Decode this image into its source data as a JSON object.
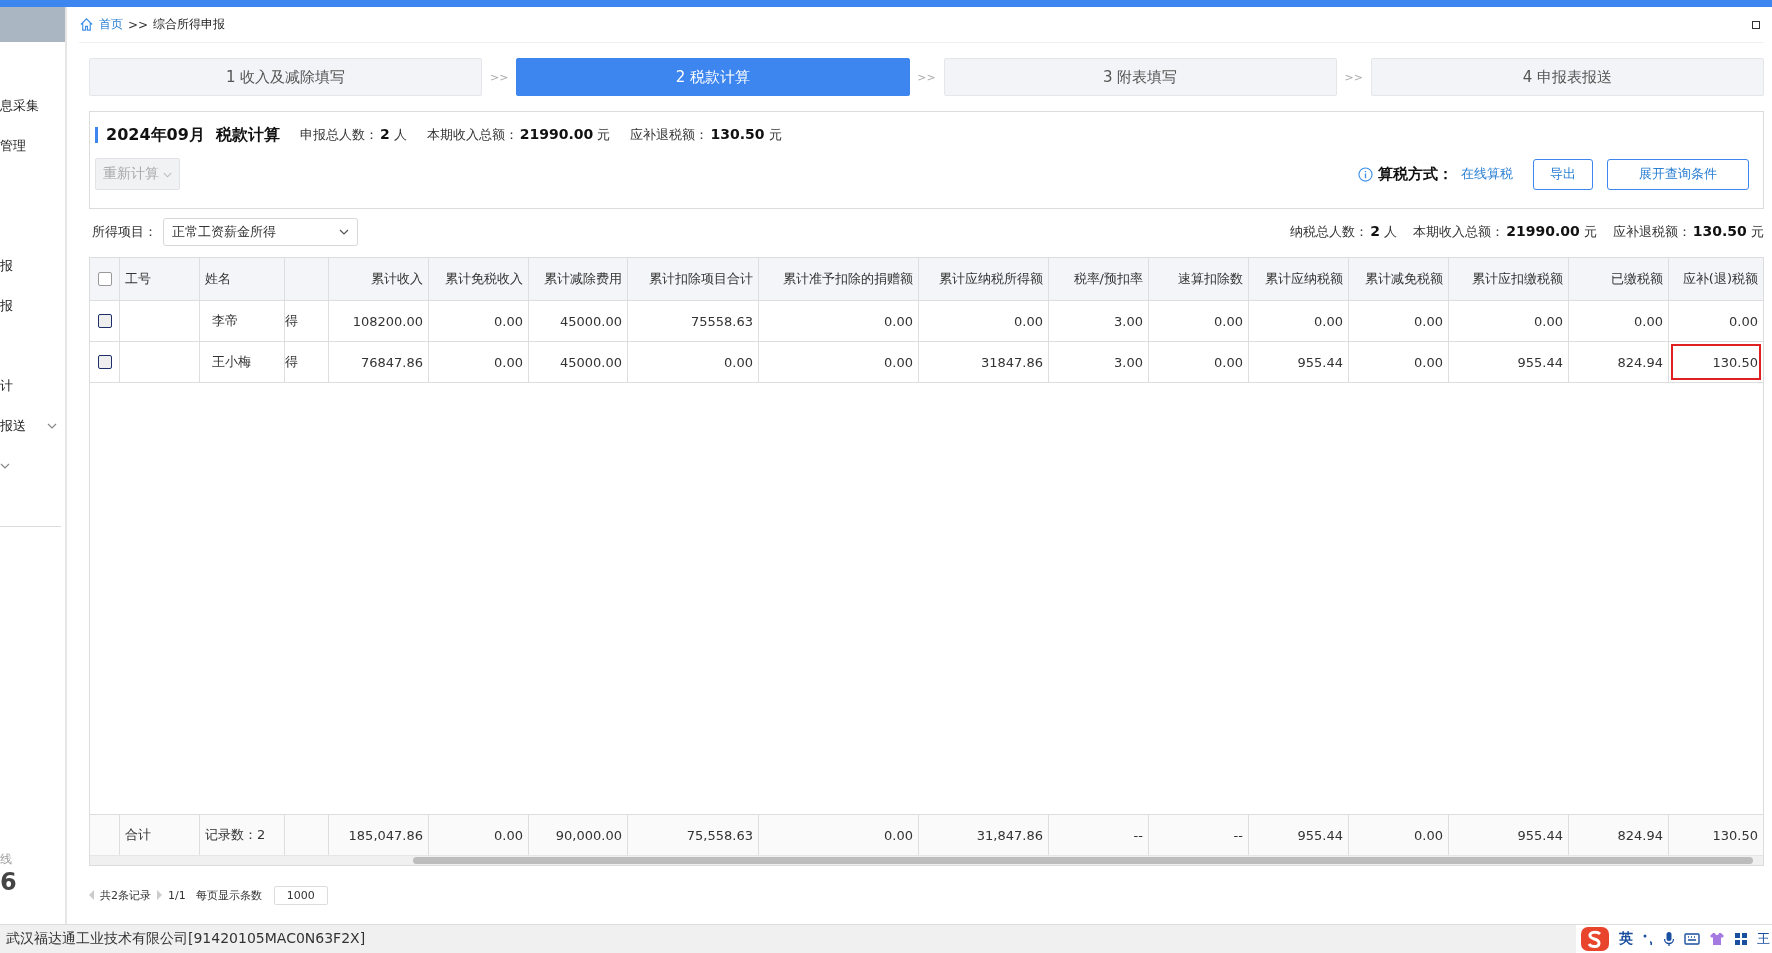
{
  "sidebar": {
    "items": [
      {
        "label": "息采集",
        "expandable": false
      },
      {
        "label": "管理",
        "expandable": false
      },
      {
        "label": "报",
        "expandable": false
      },
      {
        "label": "报",
        "expandable": false
      },
      {
        "label": "计",
        "expandable": false
      },
      {
        "label": "报送",
        "expandable": true
      },
      {
        "expandable": true
      }
    ],
    "footer_label": "线",
    "footer_number": "6"
  },
  "breadcrumb": {
    "home": "首页",
    "separator": ">>",
    "current": "综合所得申报"
  },
  "steps": [
    {
      "label": "1 收入及减除填写",
      "selected": false
    },
    {
      "label": "2 税款计算",
      "selected": true
    },
    {
      "label": "3 附表填写",
      "selected": false
    },
    {
      "label": "4 申报表报送",
      "selected": false
    }
  ],
  "step_separator": ">>",
  "summary": {
    "title": "2024年09月  税款计算",
    "stats": [
      {
        "label": "申报总人数：",
        "value": "2",
        "unit": "人"
      },
      {
        "label": "本期收入总额：",
        "value": "21990.00",
        "unit": "元"
      },
      {
        "label": "应补退税额：",
        "value": "130.50",
        "unit": "元"
      }
    ],
    "recalc_button": {
      "label": "重新计算",
      "disabled": true
    },
    "method_label": "算税方式：",
    "method_value": "在线算税",
    "buttons": [
      "导出",
      "展开查询条件"
    ]
  },
  "filter": {
    "label": "所得项目：",
    "value": "正常工资薪金所得",
    "stats": [
      {
        "label": "纳税总人数：",
        "value": "2",
        "unit": "人"
      },
      {
        "label": "本期收入总额：",
        "value": "21990.00",
        "unit": "元"
      },
      {
        "label": "应补退税额：",
        "value": "130.50",
        "unit": "元"
      }
    ]
  },
  "table": {
    "header_checked": false,
    "columns": [
      "工号",
      "姓名",
      null,
      "累计收入",
      "累计免税收入",
      "累计减除费用",
      "累计扣除项目合计",
      "累计准予扣除的捐赠额",
      "累计应纳税所得额",
      "税率/预扣率",
      "速算扣除数",
      "累计应纳税额",
      "累计减免税额",
      "累计应扣缴税额",
      "已缴税额",
      "应补(退)税额"
    ],
    "rows": [
      {
        "checked": false,
        "outlined_last": false,
        "cells": [
          null,
          "李帝",
          "得",
          "108200.00",
          "0.00",
          "45000.00",
          "75558.63",
          "0.00",
          "0.00",
          "3.00",
          "0.00",
          "0.00",
          "0.00",
          "0.00",
          "0.00",
          "0.00"
        ]
      },
      {
        "checked": false,
        "outlined_last": true,
        "cells": [
          null,
          "王小梅",
          "得",
          "76847.86",
          "0.00",
          "45000.00",
          "0.00",
          "0.00",
          "31847.86",
          "3.00",
          "0.00",
          "955.44",
          "0.00",
          "955.44",
          "824.94",
          "130.50"
        ]
      }
    ],
    "total": {
      "label": "合计",
      "count": "记录数：2",
      "values": [
        "185,047.86",
        "0.00",
        "90,000.00",
        "75,558.63",
        "0.00",
        "31,847.86",
        "--",
        "--",
        "955.44",
        "0.00",
        "955.44",
        "824.94",
        "130.50"
      ]
    }
  },
  "pager": {
    "records": "共2条记录",
    "page": "1/1",
    "per_page_label": "每页显示条数",
    "per_page": "1000"
  },
  "status_bar": {
    "company": "武汉福达通工业技术有限公司[91420105MAC0N63F2X]",
    "ime_lang": "英",
    "ime_cut": "王"
  }
}
